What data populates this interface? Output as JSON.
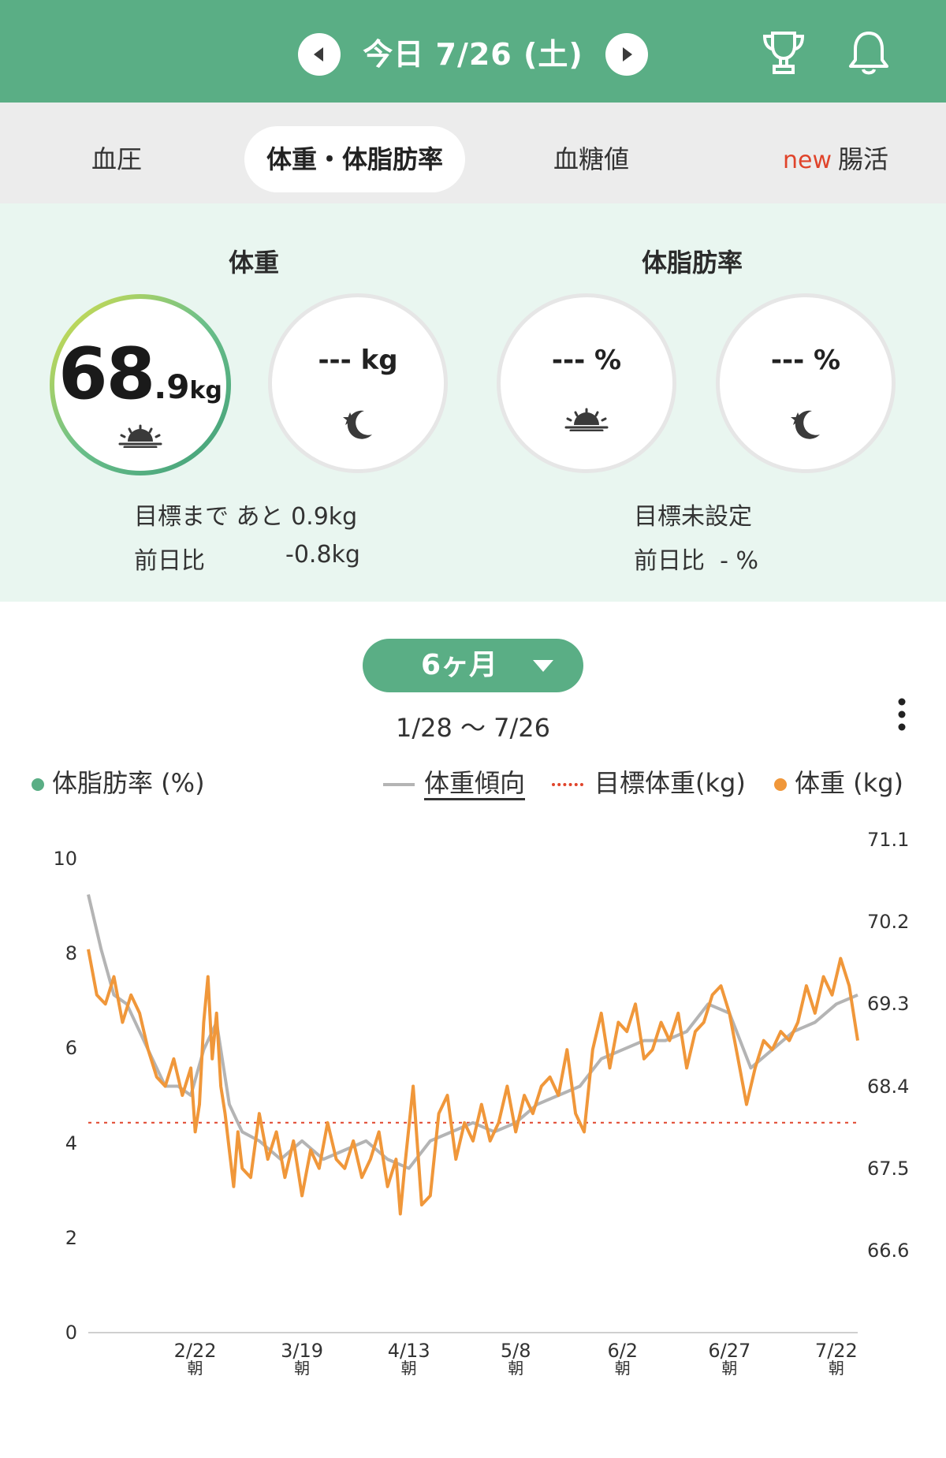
{
  "header": {
    "date": "今日 7/26 (土)",
    "prev_icon": "triangle-left-icon",
    "next_icon": "triangle-right-icon",
    "trophy_icon": "trophy-icon",
    "bell_icon": "bell-icon",
    "color": "#5aae85"
  },
  "tabs": [
    {
      "label": "血圧",
      "active": false
    },
    {
      "label": "体重・体脂肪率",
      "active": true
    },
    {
      "label": "血糖値",
      "active": false
    },
    {
      "label": "腸活",
      "badge": "new",
      "active": false
    }
  ],
  "summary": {
    "weight": {
      "title": "体重",
      "morning_int": "68",
      "morning_dec": ".9",
      "morning_unit": "kg",
      "evening": "--- kg",
      "goal_text": "目標まで あと",
      "goal_value": "0.9kg",
      "diff_label": "前日比",
      "diff_value": "-0.8kg"
    },
    "fat": {
      "title": "体脂肪率",
      "morning": "--- %",
      "evening": "--- %",
      "goal_text": "目標未設定",
      "diff_label": "前日比",
      "diff_value": "- %"
    }
  },
  "period": {
    "label": "6ヶ月",
    "range": "1/28 〜 7/26"
  },
  "legend": {
    "fat": "体脂肪率 (%)",
    "trend": "体重傾向",
    "target": "目標体重(kg)",
    "weight": "体重 (kg)"
  },
  "chart_data": {
    "type": "line",
    "left_axis": {
      "label": "",
      "ticks": [
        "10",
        "8",
        "6",
        "4",
        "2",
        "0"
      ],
      "range": [
        0,
        10.4
      ]
    },
    "right_axis": {
      "label": "",
      "ticks": [
        "71.1",
        "70.2",
        "69.3",
        "68.4",
        "67.5",
        "66.6"
      ],
      "range": [
        65.7,
        71.1
      ]
    },
    "x_ticks": [
      {
        "date": "2/22",
        "sub": "朝"
      },
      {
        "date": "3/19",
        "sub": "朝"
      },
      {
        "date": "4/13",
        "sub": "朝"
      },
      {
        "date": "5/8",
        "sub": "朝"
      },
      {
        "date": "6/2",
        "sub": "朝"
      },
      {
        "date": "6/27",
        "sub": "朝"
      },
      {
        "date": "7/22",
        "sub": "朝"
      }
    ],
    "x_range_days": [
      0,
      180
    ],
    "x_tick_days": [
      25,
      50,
      75,
      100,
      125,
      150,
      175
    ],
    "target_weight": 68.0,
    "series": [
      {
        "name": "体重 (kg)",
        "color": "#f0973a",
        "values": [
          [
            0,
            69.9
          ],
          [
            2,
            69.4
          ],
          [
            4,
            69.3
          ],
          [
            6,
            69.6
          ],
          [
            8,
            69.1
          ],
          [
            10,
            69.4
          ],
          [
            12,
            69.2
          ],
          [
            14,
            68.8
          ],
          [
            16,
            68.5
          ],
          [
            18,
            68.4
          ],
          [
            20,
            68.7
          ],
          [
            22,
            68.3
          ],
          [
            24,
            68.6
          ],
          [
            25,
            67.9
          ],
          [
            26,
            68.2
          ],
          [
            27,
            69.1
          ],
          [
            28,
            69.6
          ],
          [
            29,
            68.7
          ],
          [
            30,
            69.2
          ],
          [
            31,
            68.4
          ],
          [
            32,
            68.1
          ],
          [
            33,
            67.7
          ],
          [
            34,
            67.3
          ],
          [
            35,
            67.9
          ],
          [
            36,
            67.5
          ],
          [
            38,
            67.4
          ],
          [
            40,
            68.1
          ],
          [
            42,
            67.6
          ],
          [
            44,
            67.9
          ],
          [
            46,
            67.4
          ],
          [
            48,
            67.8
          ],
          [
            50,
            67.2
          ],
          [
            52,
            67.7
          ],
          [
            54,
            67.5
          ],
          [
            56,
            68.0
          ],
          [
            58,
            67.6
          ],
          [
            60,
            67.5
          ],
          [
            62,
            67.8
          ],
          [
            64,
            67.4
          ],
          [
            66,
            67.6
          ],
          [
            68,
            67.9
          ],
          [
            70,
            67.3
          ],
          [
            72,
            67.6
          ],
          [
            73,
            67.0
          ],
          [
            74,
            67.5
          ],
          [
            76,
            68.4
          ],
          [
            78,
            67.1
          ],
          [
            80,
            67.2
          ],
          [
            82,
            68.1
          ],
          [
            84,
            68.3
          ],
          [
            86,
            67.6
          ],
          [
            88,
            68.0
          ],
          [
            90,
            67.8
          ],
          [
            92,
            68.2
          ],
          [
            94,
            67.8
          ],
          [
            96,
            68.0
          ],
          [
            98,
            68.4
          ],
          [
            100,
            67.9
          ],
          [
            102,
            68.3
          ],
          [
            104,
            68.1
          ],
          [
            106,
            68.4
          ],
          [
            108,
            68.5
          ],
          [
            110,
            68.3
          ],
          [
            112,
            68.8
          ],
          [
            114,
            68.1
          ],
          [
            116,
            67.9
          ],
          [
            118,
            68.8
          ],
          [
            120,
            69.2
          ],
          [
            122,
            68.6
          ],
          [
            124,
            69.1
          ],
          [
            126,
            69.0
          ],
          [
            128,
            69.3
          ],
          [
            130,
            68.7
          ],
          [
            132,
            68.8
          ],
          [
            134,
            69.1
          ],
          [
            136,
            68.9
          ],
          [
            138,
            69.2
          ],
          [
            140,
            68.6
          ],
          [
            142,
            69.0
          ],
          [
            144,
            69.1
          ],
          [
            146,
            69.4
          ],
          [
            148,
            69.5
          ],
          [
            150,
            69.2
          ],
          [
            152,
            68.7
          ],
          [
            154,
            68.2
          ],
          [
            156,
            68.6
          ],
          [
            158,
            68.9
          ],
          [
            160,
            68.8
          ],
          [
            162,
            69.0
          ],
          [
            164,
            68.9
          ],
          [
            166,
            69.1
          ],
          [
            168,
            69.5
          ],
          [
            170,
            69.2
          ],
          [
            172,
            69.6
          ],
          [
            174,
            69.4
          ],
          [
            176,
            69.8
          ],
          [
            178,
            69.5
          ],
          [
            180,
            68.9
          ]
        ]
      },
      {
        "name": "体重傾向",
        "color": "#b4b4b4",
        "values": [
          [
            0,
            70.5
          ],
          [
            3,
            69.9
          ],
          [
            6,
            69.4
          ],
          [
            9,
            69.3
          ],
          [
            12,
            69.0
          ],
          [
            15,
            68.7
          ],
          [
            18,
            68.4
          ],
          [
            21,
            68.4
          ],
          [
            24,
            68.3
          ],
          [
            27,
            68.8
          ],
          [
            30,
            69.1
          ],
          [
            33,
            68.2
          ],
          [
            36,
            67.9
          ],
          [
            40,
            67.8
          ],
          [
            45,
            67.6
          ],
          [
            50,
            67.8
          ],
          [
            55,
            67.6
          ],
          [
            60,
            67.7
          ],
          [
            65,
            67.8
          ],
          [
            70,
            67.6
          ],
          [
            75,
            67.5
          ],
          [
            80,
            67.8
          ],
          [
            85,
            67.9
          ],
          [
            90,
            68.0
          ],
          [
            95,
            67.9
          ],
          [
            100,
            68.0
          ],
          [
            105,
            68.2
          ],
          [
            110,
            68.3
          ],
          [
            115,
            68.4
          ],
          [
            120,
            68.7
          ],
          [
            125,
            68.8
          ],
          [
            130,
            68.9
          ],
          [
            135,
            68.9
          ],
          [
            140,
            69.0
          ],
          [
            145,
            69.3
          ],
          [
            150,
            69.2
          ],
          [
            155,
            68.6
          ],
          [
            160,
            68.8
          ],
          [
            165,
            69.0
          ],
          [
            170,
            69.1
          ],
          [
            175,
            69.3
          ],
          [
            180,
            69.4
          ]
        ]
      }
    ]
  }
}
